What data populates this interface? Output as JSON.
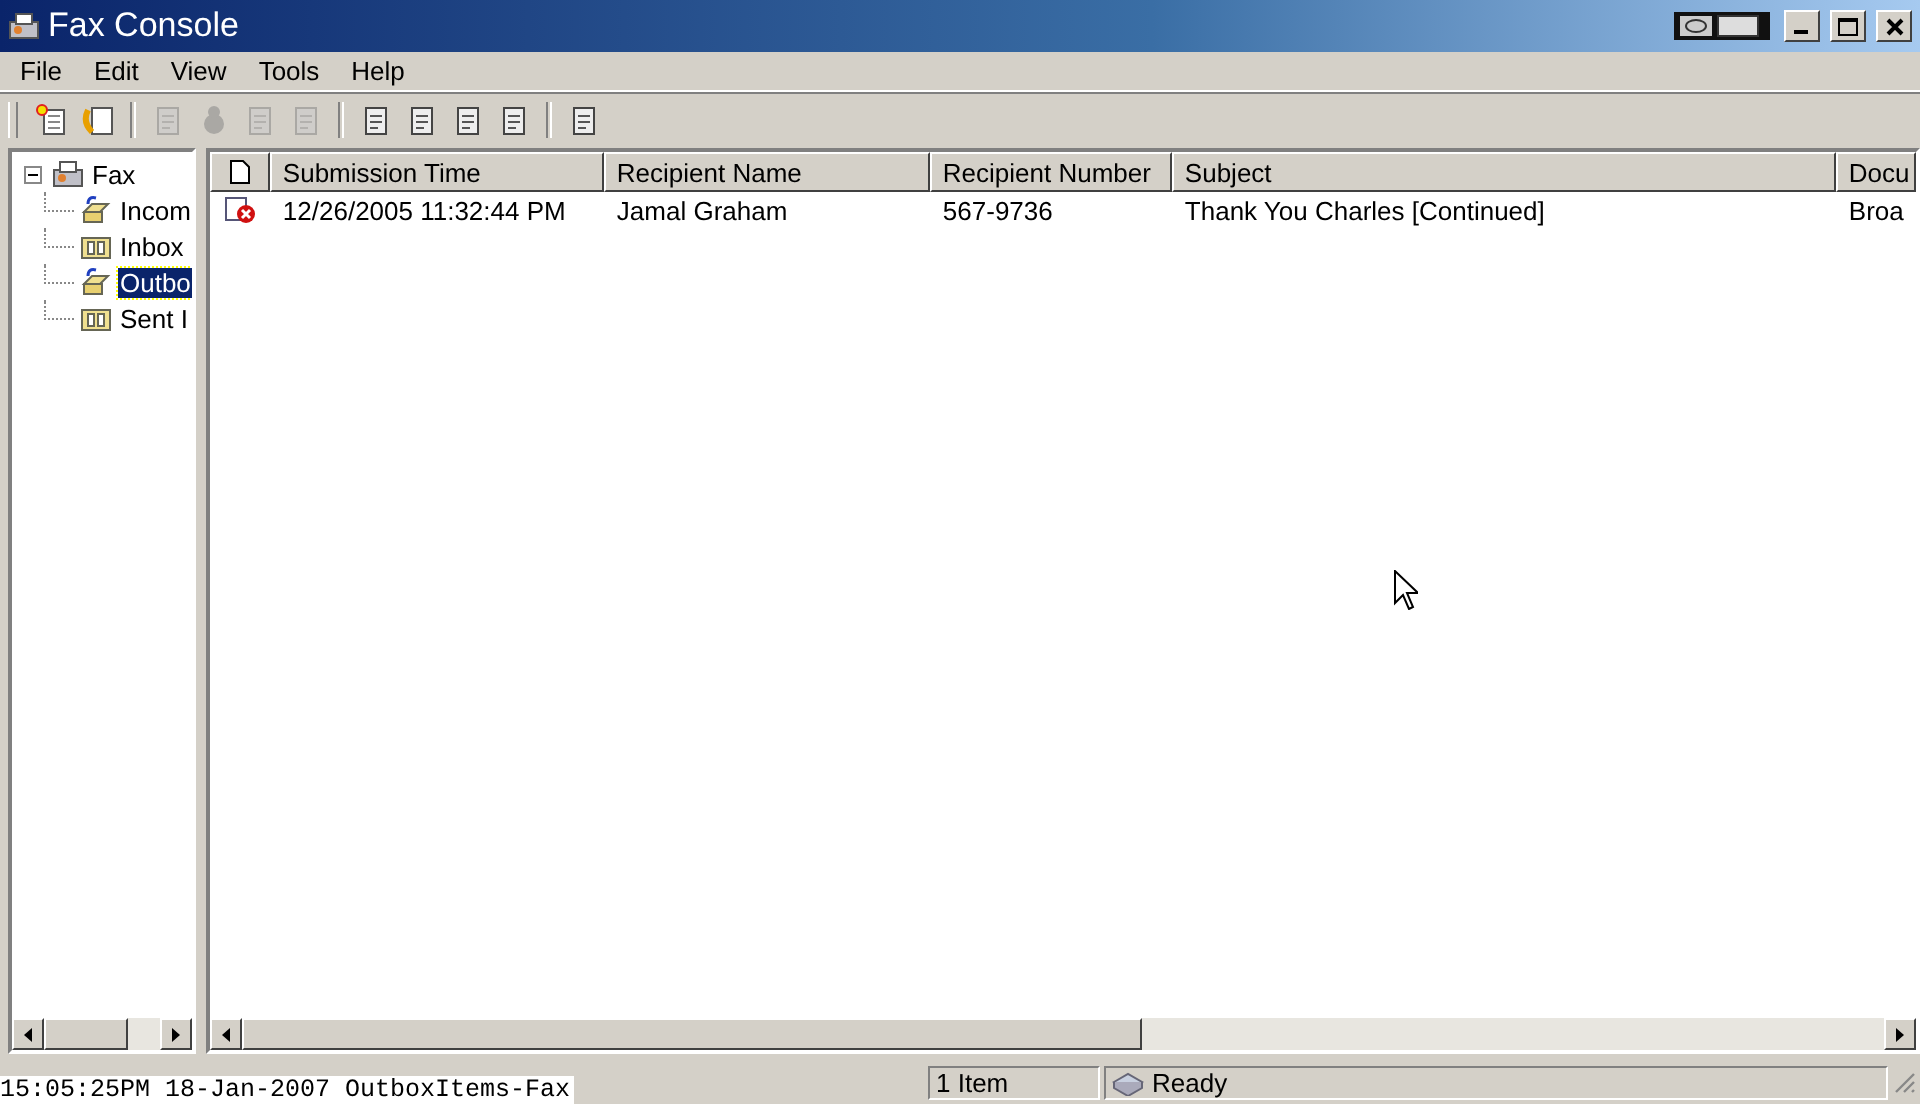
{
  "window": {
    "title": "Fax Console"
  },
  "menu": [
    "File",
    "Edit",
    "View",
    "Tools",
    "Help"
  ],
  "toolbar": [
    {
      "kind": "new",
      "disabled": false
    },
    {
      "kind": "contact",
      "disabled": false
    },
    {
      "kind": "doc",
      "disabled": true
    },
    {
      "kind": "blob",
      "disabled": true
    },
    {
      "kind": "doc",
      "disabled": true
    },
    {
      "kind": "doc",
      "disabled": true
    },
    {
      "kind": "doc",
      "disabled": false
    },
    {
      "kind": "doc",
      "disabled": false
    },
    {
      "kind": "doc",
      "disabled": false
    },
    {
      "kind": "doc",
      "disabled": false
    },
    {
      "kind": "doc",
      "disabled": false
    }
  ],
  "tree": {
    "label": "Fax",
    "expanded": true,
    "children": [
      {
        "label": "Incom",
        "kind": "tray",
        "selected": false
      },
      {
        "label": "Inbox",
        "kind": "folder",
        "selected": false
      },
      {
        "label": "Outbo",
        "kind": "tray",
        "selected": true
      },
      {
        "label": "Sent I",
        "kind": "folder",
        "selected": false
      }
    ]
  },
  "table": {
    "columns": [
      "Submission Time",
      "Recipient Name",
      "Recipient Number",
      "Subject",
      "Docu"
    ],
    "rows": [
      {
        "kind": "error",
        "cells": [
          "12/26/2005 11:32:44 PM",
          "Jamal Graham",
          "567-9736",
          "Thank You Charles [Continued]",
          "Broa"
        ]
      }
    ]
  },
  "status_bar": {
    "count": "1 Item",
    "state": "Ready"
  },
  "overlay_stamp": "15:05:25PM 18-Jan-2007 OutboxItems-Fax"
}
